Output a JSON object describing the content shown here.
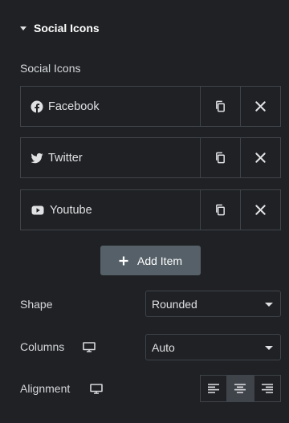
{
  "section": {
    "title": "Social Icons",
    "caret_icon": "caret-down-icon"
  },
  "repeater": {
    "label": "Social Icons",
    "items": [
      {
        "label": "Facebook",
        "icon": "facebook-icon"
      },
      {
        "label": "Twitter",
        "icon": "twitter-icon"
      },
      {
        "label": "Youtube",
        "icon": "youtube-icon"
      }
    ],
    "duplicate_icon": "copy-icon",
    "remove_icon": "close-icon"
  },
  "add_item": {
    "label": "Add Item",
    "icon": "plus-icon"
  },
  "controls": {
    "shape": {
      "label": "Shape",
      "value": "Rounded"
    },
    "columns": {
      "label": "Columns",
      "value": "Auto",
      "responsive_icon": "desktop-icon"
    },
    "alignment": {
      "label": "Alignment",
      "responsive_icon": "desktop-icon",
      "options": [
        "align-left-icon",
        "align-center-icon",
        "align-right-icon"
      ],
      "selected": "align-center-icon"
    }
  },
  "colors": {
    "background": "#1f2124",
    "border": "#3f444b",
    "text": "#e0e1e3",
    "button": "#556068",
    "active": "#3f444b"
  }
}
